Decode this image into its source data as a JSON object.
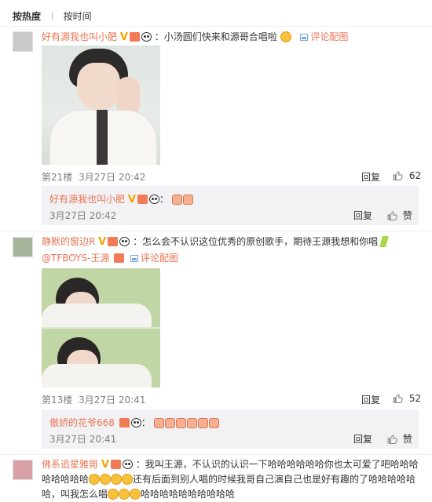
{
  "tabs": {
    "hot": "按热度",
    "time": "按时间"
  },
  "c1": {
    "user": "好有源我也叫小肥",
    "text": "：小汤圆们快来和源哥合唱啦",
    "img_link": "评论配图",
    "floor": "第21楼",
    "time": "3月27日 20:42",
    "reply": "回复",
    "likes": "62",
    "sub": {
      "user": "好有源我也叫小肥",
      "time": "3月27日 20:42",
      "reply": "回复",
      "like": "赞"
    }
  },
  "c2": {
    "user": "静默的窗边R",
    "text": "：怎么会不认识这位优秀的原创歌手，期待王源我想和你唱",
    "mention": "@TFBOYS-王源",
    "img_link": "评论配图",
    "floor": "第13楼",
    "time": "3月27日 20:41",
    "reply": "回复",
    "likes": "52",
    "sub": {
      "user": "傲娇的花爷668",
      "time": "3月27日 20:41",
      "reply": "回复",
      "like": "赞"
    }
  },
  "c3": {
    "user": "佛系追星雅哥",
    "line1": "：我叫王源，不认识的认识一下哈哈哈哈哈哈你也太可爱了吧哈哈哈",
    "line2_a": "哈哈哈哈哈",
    "line2_b": "还有后面到别人唱的时候我哥自己演自己也是好有趣的了哈哈哈哈哈",
    "line3_a": "哈，叫我怎么唱",
    "line3_b": "哈哈哈哈哈哈哈哈哈哈"
  },
  "colors": {
    "username": "#eb7350",
    "v_badge": "#f5a300",
    "reply_bg": "#f2f2f5"
  }
}
